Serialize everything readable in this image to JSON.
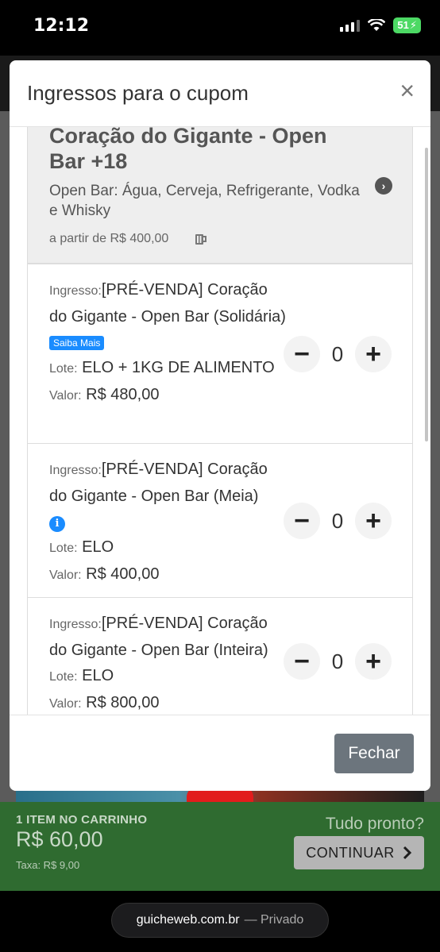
{
  "status": {
    "time": "12:12",
    "battery": "51"
  },
  "cart": {
    "count_label": "1 ITEM NO CARRINHO",
    "total": "R$ 60,00",
    "tax": "Taxa: R$ 9,00",
    "ready_label": "Tudo pronto?",
    "continue_label": "CONTINUAR"
  },
  "browser": {
    "url": "guicheweb.com.br",
    "private_label": "— Privado"
  },
  "modal": {
    "title": "Ingressos para o cupom",
    "close_label": "×",
    "event": {
      "title": "Coração do Gigante - Open Bar +18",
      "description": "Open Bar: Água, Cerveja, Refrigerante, Vodka e Whisky",
      "price_from": "a partir de R$ 400,00"
    },
    "labels": {
      "ingresso": "Ingresso:",
      "lote": "Lote:",
      "valor": "Valor:"
    },
    "tickets": [
      {
        "name": "[PRÉ-VENDA] Coração do Gigante - Open Bar (Solidária)",
        "badge": "Saiba Mais",
        "lote": "ELO + 1KG DE ALIMENTO",
        "valor": "R$ 480,00",
        "qty": "0"
      },
      {
        "name": "[PRÉ-VENDA] Coração do Gigante - Open Bar (Meia)",
        "info_icon": "i",
        "lote": "ELO",
        "valor": "R$ 400,00",
        "qty": "0"
      },
      {
        "name": "[PRÉ-VENDA] Coração do Gigante - Open Bar (Inteira)",
        "lote": "ELO",
        "valor": "R$ 800,00",
        "qty": "0"
      }
    ],
    "footer": {
      "close_button": "Fechar"
    }
  },
  "icons": {
    "close": "close-icon",
    "arrow": "chevron-right-circle-icon",
    "beer": "beer-mug-icon",
    "minus": "minus-icon",
    "plus": "plus-icon",
    "info": "info-icon"
  },
  "colors": {
    "cart_bar": "#2f6b30",
    "badge": "#1a8cff",
    "fechar_button": "#6c757d"
  }
}
